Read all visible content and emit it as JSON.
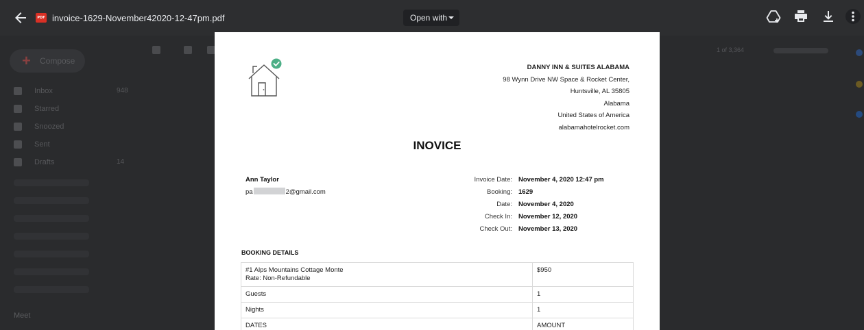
{
  "viewer": {
    "file_name": "invoice-1629-November42020-12-47pm.pdf",
    "file_type_badge": "PDF",
    "open_with_label": "Open with",
    "actions": [
      {
        "name": "add-to-drive",
        "icon": "drive-add-icon"
      },
      {
        "name": "print",
        "icon": "print-icon"
      },
      {
        "name": "download",
        "icon": "download-icon"
      },
      {
        "name": "more",
        "icon": "more-vert-icon"
      }
    ]
  },
  "gmail_background": {
    "compose_label": "Compose",
    "nav": [
      {
        "label": "Inbox",
        "count": "948",
        "icon": "inbox-icon"
      },
      {
        "label": "Starred",
        "count": "",
        "icon": "star-icon"
      },
      {
        "label": "Snoozed",
        "count": "",
        "icon": "clock-icon"
      },
      {
        "label": "Sent",
        "count": "",
        "icon": "send-icon"
      },
      {
        "label": "Drafts",
        "count": "14",
        "icon": "draft-icon"
      }
    ],
    "meet_label": "Meet",
    "pager_text": "1 of 3,364"
  },
  "invoice": {
    "hotel": {
      "name": "DANNY INN & SUITES ALABAMA",
      "address_line1": "98 Wynn Drive NW Space & Rocket Center,",
      "address_line2": "Huntsville, AL 35805",
      "state": "Alabama",
      "country": "United States of America",
      "website": "alabamahotelrocket.com"
    },
    "title": "INOVICE",
    "bill_to": {
      "name": "Ann Taylor",
      "email_prefix": "pa",
      "email_suffix": "2@gmail.com"
    },
    "meta": [
      {
        "label": "Invoice Date:",
        "value": "November 4, 2020 12:47 pm"
      },
      {
        "label": "Booking:",
        "value": "1629"
      },
      {
        "label": "Date:",
        "value": "November 4, 2020"
      },
      {
        "label": "Check In:",
        "value": "November 12, 2020"
      },
      {
        "label": "Check Out:",
        "value": "November 13, 2020"
      }
    ],
    "booking_details_heading": "BOOKING DETAILS",
    "booking_rows": [
      {
        "item": "#1 Alps Mountains Cottage Monte",
        "sub": "Rate: Non-Refundable",
        "value": "$950"
      },
      {
        "item": "Guests",
        "sub": "",
        "value": "1"
      },
      {
        "item": "Nights",
        "sub": "",
        "value": "1"
      },
      {
        "item": "DATES",
        "sub": "",
        "value": "AMOUNT"
      }
    ]
  },
  "colors": {
    "viewer_bar": "#2d2e30",
    "backdrop": "#2a2b2d",
    "pdf_badge": "#d93025",
    "logo_check": "#4caf86"
  }
}
